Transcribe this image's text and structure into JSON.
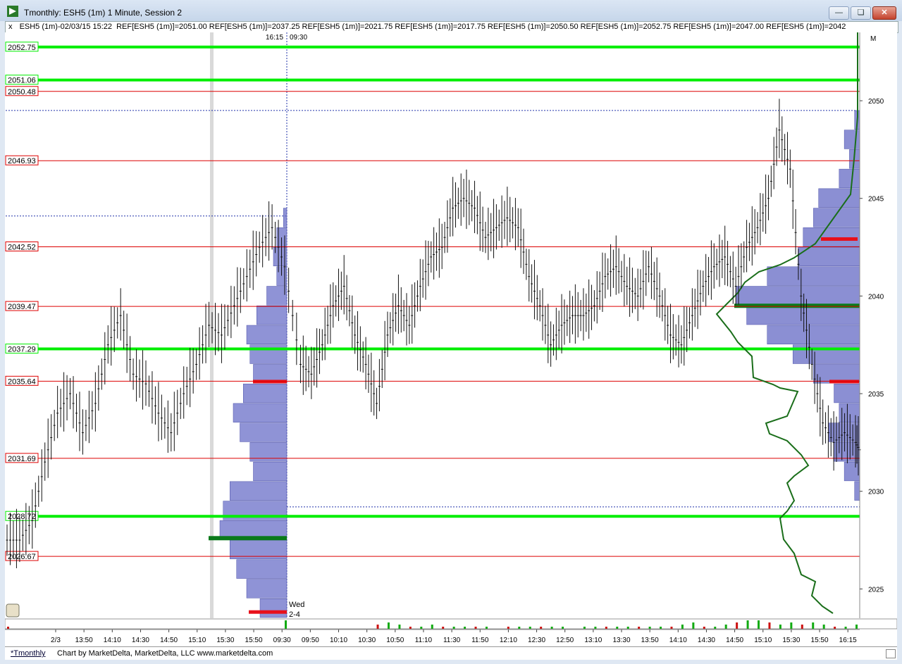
{
  "window": {
    "title": "Tmonthly: ESH5 (1m) 1 Minute, Session 2",
    "buttons": {
      "minimize": "minimize-icon",
      "maximize": "restore-icon",
      "close": "close-icon"
    }
  },
  "legend": {
    "close_glyph": "x",
    "instrument": "ESH5 (1m)-02/03/15 15:22",
    "refs": [
      {
        "text": "REF[ESH5 (1m)]=2051.00",
        "color": "#00cc00"
      },
      {
        "text": "REF[ESH5 (1m)]=2037.25",
        "color": "#00cc00"
      },
      {
        "text": "REF[ESH5 (1m)]=2021.75",
        "color": "#ff0000"
      },
      {
        "text": "REF[ESH5 (1m)]=2017.75",
        "color": "#ff0000"
      },
      {
        "text": "REF[ESH5 (1m)]=2050.50",
        "color": "#ff0000"
      },
      {
        "text": "REF[ESH5 (1m)]=2052.75",
        "color": "#00cc00"
      },
      {
        "text": "REF[ESH5 (1m)]=2047.00",
        "color": "#ff0000"
      },
      {
        "text": "REF[ESH5 (1m)]=2042",
        "color": "#ff0000"
      }
    ]
  },
  "chart_data": {
    "type": "candlestick",
    "y_axis": {
      "range": [
        2023.5,
        2053.5
      ],
      "ticks": [
        "2050",
        "2045",
        "2040",
        "2035",
        "2030",
        "2025"
      ],
      "corner_label": "M"
    },
    "x_axis": {
      "ticks": [
        "2/3",
        "13:50",
        "14:10",
        "14:30",
        "14:50",
        "15:10",
        "15:30",
        "15:50",
        "09:30",
        "09:50",
        "10:10",
        "10:30",
        "10:50",
        "11:10",
        "11:30",
        "11:50",
        "12:10",
        "12:30",
        "12:50",
        "13:10",
        "13:30",
        "13:50",
        "14:10",
        "14:30",
        "14:50",
        "15:10",
        "15:30",
        "15:50",
        "16:15"
      ]
    },
    "session_markers": {
      "break_label_left": "16:15",
      "break_label_right": "09:30",
      "profile_label": [
        "Wed",
        "2-4"
      ]
    },
    "reference_lines": [
      {
        "price": 2052.75,
        "label": "2052.75",
        "color": "#00ee00",
        "style": "thick"
      },
      {
        "price": 2051.06,
        "label": "2051.06",
        "color": "#00ee00",
        "style": "thick"
      },
      {
        "price": 2050.48,
        "label": "2050.48",
        "color": "#dd0000",
        "style": "thin"
      },
      {
        "price": 2046.93,
        "label": "2046.93",
        "color": "#dd0000",
        "style": "thin"
      },
      {
        "price": 2042.52,
        "label": "2042.52",
        "color": "#dd0000",
        "style": "thin"
      },
      {
        "price": 2039.47,
        "label": "2039.47",
        "color": "#dd0000",
        "style": "thin"
      },
      {
        "price": 2037.29,
        "label": "2037.29",
        "color": "#00ee00",
        "style": "thick"
      },
      {
        "price": 2035.64,
        "label": "2035.64",
        "color": "#dd0000",
        "style": "thin"
      },
      {
        "price": 2031.69,
        "label": "2031.69",
        "color": "#dd0000",
        "style": "thin"
      },
      {
        "price": 2028.72,
        "label": "2028.72",
        "color": "#00ee00",
        "style": "thick"
      },
      {
        "price": 2026.67,
        "label": "2026.67",
        "color": "#dd0000",
        "style": "thin"
      }
    ],
    "range_dotted_lines": [
      2049.5,
      2044.1,
      2029.2
    ],
    "price_path": [
      {
        "t": 0,
        "p": 2027.5
      },
      {
        "t": 1,
        "p": 2028.5
      },
      {
        "t": 2,
        "p": 2031.5
      },
      {
        "t": 3,
        "p": 2034.0
      },
      {
        "t": 4,
        "p": 2035.0
      },
      {
        "t": 5,
        "p": 2033.0
      },
      {
        "t": 6,
        "p": 2034.5
      },
      {
        "t": 7,
        "p": 2037.5
      },
      {
        "t": 8,
        "p": 2039.0
      },
      {
        "t": 9,
        "p": 2036.0
      },
      {
        "t": 10,
        "p": 2035.5
      },
      {
        "t": 11,
        "p": 2034.0
      },
      {
        "t": 12,
        "p": 2033.0
      },
      {
        "t": 13,
        "p": 2035.0
      },
      {
        "t": 14,
        "p": 2036.5
      },
      {
        "t": 15,
        "p": 2038.5
      },
      {
        "t": 16,
        "p": 2038.0
      },
      {
        "t": 17,
        "p": 2039.5
      },
      {
        "t": 18,
        "p": 2041.0
      },
      {
        "t": 19,
        "p": 2042.5
      },
      {
        "t": 20,
        "p": 2043.5
      },
      {
        "t": 21,
        "p": 2041.5
      },
      {
        "t": 22,
        "p": 2036.5
      },
      {
        "t": 23,
        "p": 2036.0
      },
      {
        "t": 24,
        "p": 2037.5
      },
      {
        "t": 25,
        "p": 2039.5
      },
      {
        "t": 26,
        "p": 2040.5
      },
      {
        "t": 27,
        "p": 2038.0
      },
      {
        "t": 28,
        "p": 2036.5
      },
      {
        "t": 29,
        "p": 2034.5
      },
      {
        "t": 30,
        "p": 2038.0
      },
      {
        "t": 31,
        "p": 2039.5
      },
      {
        "t": 32,
        "p": 2038.5
      },
      {
        "t": 33,
        "p": 2040.5
      },
      {
        "t": 34,
        "p": 2042.0
      },
      {
        "t": 35,
        "p": 2042.5
      },
      {
        "t": 36,
        "p": 2044.5
      },
      {
        "t": 37,
        "p": 2045.0
      },
      {
        "t": 38,
        "p": 2044.5
      },
      {
        "t": 39,
        "p": 2043.0
      },
      {
        "t": 40,
        "p": 2043.5
      },
      {
        "t": 41,
        "p": 2044.0
      },
      {
        "t": 42,
        "p": 2043.5
      },
      {
        "t": 43,
        "p": 2041.0
      },
      {
        "t": 44,
        "p": 2039.5
      },
      {
        "t": 45,
        "p": 2037.5
      },
      {
        "t": 46,
        "p": 2038.5
      },
      {
        "t": 47,
        "p": 2039.0
      },
      {
        "t": 48,
        "p": 2039.0
      },
      {
        "t": 49,
        "p": 2039.5
      },
      {
        "t": 50,
        "p": 2041.0
      },
      {
        "t": 51,
        "p": 2041.5
      },
      {
        "t": 52,
        "p": 2040.5
      },
      {
        "t": 53,
        "p": 2040.0
      },
      {
        "t": 54,
        "p": 2041.5
      },
      {
        "t": 55,
        "p": 2040.0
      },
      {
        "t": 56,
        "p": 2038.0
      },
      {
        "t": 57,
        "p": 2037.5
      },
      {
        "t": 58,
        "p": 2039.0
      },
      {
        "t": 59,
        "p": 2040.5
      },
      {
        "t": 60,
        "p": 2041.5
      },
      {
        "t": 61,
        "p": 2042.0
      },
      {
        "t": 62,
        "p": 2040.5
      },
      {
        "t": 63,
        "p": 2042.5
      },
      {
        "t": 64,
        "p": 2043.5
      },
      {
        "t": 65,
        "p": 2045.0
      },
      {
        "t": 66,
        "p": 2048.5
      },
      {
        "t": 67,
        "p": 2046.5
      },
      {
        "t": 68,
        "p": 2040.0
      },
      {
        "t": 69,
        "p": 2036.5
      },
      {
        "t": 70,
        "p": 2033.5
      },
      {
        "t": 71,
        "p": 2032.5
      },
      {
        "t": 72,
        "p": 2033.0
      },
      {
        "t": 73,
        "p": 2032.5
      },
      {
        "t": 74,
        "p": 2032.0
      }
    ],
    "volume_profiles": [
      {
        "name": "prior-session",
        "poc": 2027.6,
        "va_marks": [
          2035.6,
          2023.8
        ],
        "levels": [
          [
            2044.0,
            1
          ],
          [
            2043.0,
            3
          ],
          [
            2042.0,
            4
          ],
          [
            2041.0,
            3
          ],
          [
            2040.0,
            6
          ],
          [
            2039.0,
            9
          ],
          [
            2038.0,
            12
          ],
          [
            2037.0,
            11
          ],
          [
            2036.0,
            10
          ],
          [
            2035.0,
            13
          ],
          [
            2034.0,
            16
          ],
          [
            2033.0,
            14
          ],
          [
            2032.0,
            11
          ],
          [
            2031.0,
            10
          ],
          [
            2030.0,
            17
          ],
          [
            2029.0,
            19
          ],
          [
            2028.0,
            20
          ],
          [
            2027.0,
            17
          ],
          [
            2026.0,
            15
          ],
          [
            2025.0,
            12
          ],
          [
            2024.0,
            8
          ]
        ]
      },
      {
        "name": "current-session",
        "poc": 2039.5,
        "va_marks": [
          2042.9,
          2035.6
        ],
        "levels": [
          [
            2049.0,
            1
          ],
          [
            2048.0,
            3
          ],
          [
            2047.0,
            2
          ],
          [
            2046.0,
            4
          ],
          [
            2045.0,
            8
          ],
          [
            2044.0,
            9
          ],
          [
            2043.0,
            11
          ],
          [
            2042.0,
            12
          ],
          [
            2041.0,
            18
          ],
          [
            2040.0,
            24
          ],
          [
            2039.0,
            22
          ],
          [
            2038.0,
            18
          ],
          [
            2037.0,
            13
          ],
          [
            2036.0,
            9
          ],
          [
            2035.0,
            5
          ],
          [
            2034.0,
            4
          ],
          [
            2033.0,
            6
          ],
          [
            2032.0,
            5
          ],
          [
            2031.0,
            3
          ],
          [
            2030.0,
            1
          ]
        ]
      }
    ],
    "volume_bars": [
      1,
      0,
      0,
      0,
      0,
      0,
      0,
      0,
      0,
      0,
      0,
      0,
      0,
      0,
      0,
      0,
      0,
      0,
      0,
      0,
      0,
      0,
      4,
      0,
      0,
      0,
      0,
      0,
      0,
      0,
      2,
      3,
      2,
      1,
      1,
      2,
      1,
      1,
      1,
      1,
      1,
      0,
      1,
      1,
      1,
      1,
      1,
      1,
      0,
      1,
      1,
      1,
      1,
      1,
      1,
      1,
      1,
      1,
      2,
      3,
      1,
      1,
      2,
      3,
      4,
      4,
      3,
      2,
      3,
      2,
      3,
      2,
      1,
      1,
      2
    ]
  },
  "footer": {
    "tab": "*Tmonthly",
    "credit": "Chart by MarketDelta, MarketDelta, LLC www.marketdelta.com"
  }
}
